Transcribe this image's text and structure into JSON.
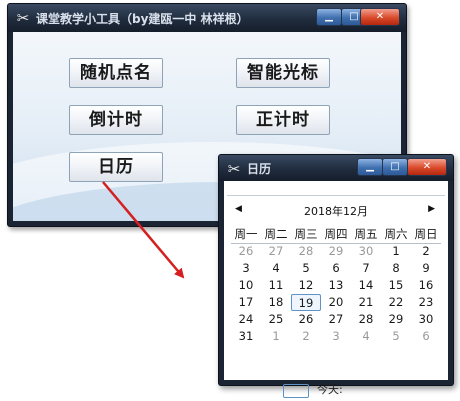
{
  "main_window": {
    "title": "课堂教学小工具（by建瓯一中 林祥根）",
    "controls": {
      "minimize": "▁",
      "maximize": "□",
      "close": "✕"
    },
    "buttons": {
      "random_name": "随机点名",
      "smart_cursor": "智能光标",
      "countdown": "倒计时",
      "countup": "正计时",
      "calendar": "日历"
    }
  },
  "calendar_window": {
    "title": "日历",
    "controls": {
      "minimize": "▁",
      "maximize": "□",
      "close": "✕"
    },
    "nav": {
      "prev": "◀",
      "next": "▶"
    },
    "month_label": "2018年12月",
    "weekdays": [
      "周一",
      "周二",
      "周三",
      "周四",
      "周五",
      "周六",
      "周日"
    ],
    "weeks": [
      [
        {
          "d": "26",
          "o": true
        },
        {
          "d": "27",
          "o": true
        },
        {
          "d": "28",
          "o": true
        },
        {
          "d": "29",
          "o": true
        },
        {
          "d": "30",
          "o": true
        },
        {
          "d": "1"
        },
        {
          "d": "2"
        }
      ],
      [
        {
          "d": "3"
        },
        {
          "d": "4"
        },
        {
          "d": "5"
        },
        {
          "d": "6"
        },
        {
          "d": "7"
        },
        {
          "d": "8"
        },
        {
          "d": "9"
        }
      ],
      [
        {
          "d": "10"
        },
        {
          "d": "11"
        },
        {
          "d": "12"
        },
        {
          "d": "13"
        },
        {
          "d": "14"
        },
        {
          "d": "15"
        },
        {
          "d": "16"
        }
      ],
      [
        {
          "d": "17"
        },
        {
          "d": "18"
        },
        {
          "d": "19",
          "t": true
        },
        {
          "d": "20"
        },
        {
          "d": "21"
        },
        {
          "d": "22"
        },
        {
          "d": "23"
        }
      ],
      [
        {
          "d": "24"
        },
        {
          "d": "25"
        },
        {
          "d": "26"
        },
        {
          "d": "27"
        },
        {
          "d": "28"
        },
        {
          "d": "29"
        },
        {
          "d": "30"
        }
      ],
      [
        {
          "d": "31"
        },
        {
          "d": "1",
          "o": true
        },
        {
          "d": "2",
          "o": true
        },
        {
          "d": "3",
          "o": true
        },
        {
          "d": "4",
          "o": true
        },
        {
          "d": "5",
          "o": true
        },
        {
          "d": "6",
          "o": true
        }
      ]
    ],
    "today_label": "今天:"
  },
  "colors": {
    "arrow": "#d42020",
    "today_border": "#5f93c7",
    "other_month_text": "#999999"
  }
}
